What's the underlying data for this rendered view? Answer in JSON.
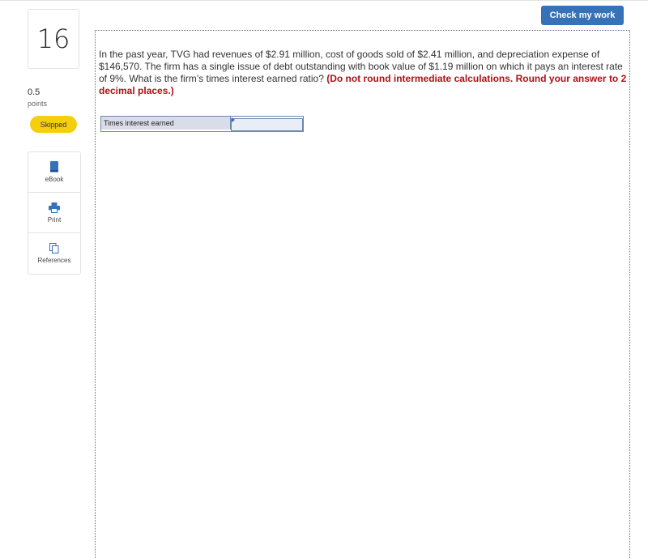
{
  "header": {
    "check_label": "Check my work"
  },
  "question": {
    "number": "16",
    "points_value": "0.5",
    "points_label": "points",
    "status": "Skipped",
    "text_plain": "In the past year, TVG had revenues of $2.91 million, cost of goods sold of $2.41 million, and depreciation expense of $146,570. The firm has a single issue of debt outstanding with book value of $1.19 million on which it pays an interest rate of 9%. What is the firm’s times interest earned ratio? ",
    "text_emphasis": "(Do not round intermediate calculations. Round your answer to 2 decimal places.)"
  },
  "tools": [
    {
      "label": "eBook",
      "icon": "book-icon"
    },
    {
      "label": "Print",
      "icon": "printer-icon"
    },
    {
      "label": "References",
      "icon": "copy-icon"
    }
  ],
  "answer": {
    "label": "Times interest earned",
    "value": ""
  },
  "colors": {
    "accent": "#3572b7",
    "status": "#f5cf0e",
    "emphasis": "#b00f17"
  }
}
